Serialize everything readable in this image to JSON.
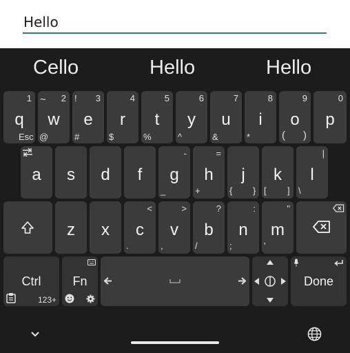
{
  "input": {
    "text": "Hello"
  },
  "suggestions": [
    "Cello",
    "Hello",
    "Hello"
  ],
  "rows": {
    "r1": [
      {
        "main": "q",
        "tl": "Esc",
        "tr": "1",
        "tm": ""
      },
      {
        "main": "w",
        "tl": "~",
        "tr": "2",
        "bl": "@"
      },
      {
        "main": "e",
        "tl": "!",
        "tr": "3",
        "bl": "#"
      },
      {
        "main": "r",
        "tr": "4",
        "bl": "$"
      },
      {
        "main": "t",
        "tr": "5",
        "bl": "%"
      },
      {
        "main": "y",
        "tr": "6",
        "bl": "^"
      },
      {
        "main": "u",
        "tr": "7",
        "bl": "&"
      },
      {
        "main": "i",
        "tr": "8",
        "bl": "*"
      },
      {
        "main": "o",
        "tr": "9",
        "bl": "(",
        "br": ")"
      },
      {
        "main": "p",
        "tr": "0"
      }
    ],
    "r2": [
      {
        "main": "a"
      },
      {
        "main": "s"
      },
      {
        "main": "d"
      },
      {
        "main": "f"
      },
      {
        "main": "g",
        "tr": "-",
        "bl": "_"
      },
      {
        "main": "h",
        "tr": "=",
        "bl": "+"
      },
      {
        "main": "j",
        "bl": "{",
        "br": "}"
      },
      {
        "main": "k",
        "bl": "[",
        "br": "]"
      },
      {
        "main": "l",
        "tr": "|",
        "bl": "\\"
      }
    ],
    "r3": [
      {
        "main": "z"
      },
      {
        "main": "x"
      },
      {
        "main": "c",
        "tr": "<",
        "bl": "."
      },
      {
        "main": "v",
        "tr": ">",
        "bl": ","
      },
      {
        "main": "b",
        "tr": "?",
        "bl": "/"
      },
      {
        "main": "n",
        "tr": ":",
        "bl": ";"
      },
      {
        "main": "m",
        "tr": "\"",
        "bl": "'"
      }
    ]
  },
  "bottom": {
    "ctrl": "Ctrl",
    "fn": "Fn",
    "num": "123+",
    "done": "Done"
  }
}
